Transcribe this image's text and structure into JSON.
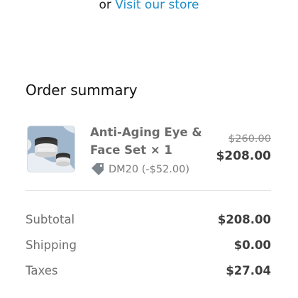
{
  "store": {
    "prefix": "or",
    "link_label": "Visit our store"
  },
  "summary": {
    "title": "Order summary"
  },
  "item": {
    "name": "Anti-Aging Eye & Face Set × 1",
    "discount_code": "DM20 (-$52.00)",
    "original_price": "$260.00",
    "final_price": "$208.00",
    "thumbnail_icon": "skincare-product-image",
    "discount_icon": "tag-icon"
  },
  "totals": [
    {
      "label": "Subtotal",
      "value": "$208.00"
    },
    {
      "label": "Shipping",
      "value": "$0.00"
    },
    {
      "label": "Taxes",
      "value": "$27.04"
    }
  ],
  "colors": {
    "link": "#1f8ec9",
    "thumbnail_bg": "#9fb6cc"
  }
}
